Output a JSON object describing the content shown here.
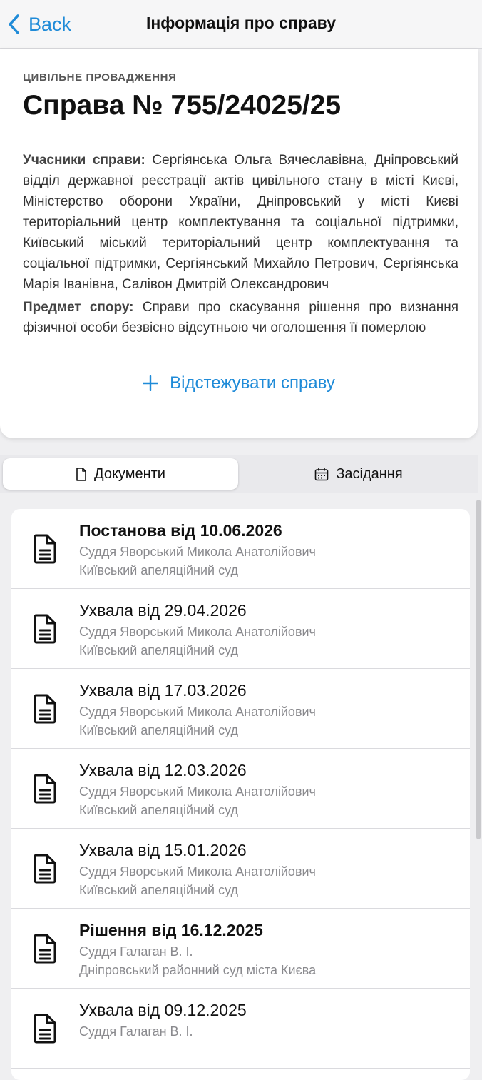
{
  "navbar": {
    "back_label": "Back",
    "title": "Інформація про справу"
  },
  "case": {
    "kind": "ЦИВІЛЬНЕ ПРОВАДЖЕННЯ",
    "title": "Справа № 755/24025/25",
    "participants_label": "Учасники справи:",
    "participants": "Сергіянська Ольга Вячеславівна, Дніпровський відділ державної реєстрації актів цивільного стану в місті Києві, Міністерство оборони України, Дніпровський у місті Києві територіальний центр комплектування та соціальної підтримки, Київський міський територіальний центр комплектування та соціальної підтримки, Сергіянський Михайло Петрович, Сергіянська Марія Іванівна, Салівон Дмитрій Олександрович",
    "subject_label": "Предмет спору:",
    "subject": "Справи про скасування рішення про визнання фізичної особи безвісно відсутньою чи оголошення її померлою",
    "track_label": "Відстежувати справу"
  },
  "tabs": {
    "documents": "Документи",
    "sessions": "Засідання",
    "active": "documents"
  },
  "documents": [
    {
      "title": "Постанова від 10.06.2026",
      "bold": true,
      "judge": "Суддя Яворський Микола Анатолійович",
      "court": "Київський апеляційний суд"
    },
    {
      "title": "Ухвала від 29.04.2026",
      "bold": false,
      "judge": "Суддя Яворський Микола Анатолійович",
      "court": "Київський апеляційний суд"
    },
    {
      "title": "Ухвала від 17.03.2026",
      "bold": false,
      "judge": "Суддя Яворський Микола Анатолійович",
      "court": "Київський апеляційний суд"
    },
    {
      "title": "Ухвала від 12.03.2026",
      "bold": false,
      "judge": "Суддя Яворський Микола Анатолійович",
      "court": "Київський апеляційний суд"
    },
    {
      "title": "Ухвала від 15.01.2026",
      "bold": false,
      "judge": "Суддя Яворський Микола Анатолійович",
      "court": "Київський апеляційний суд"
    },
    {
      "title": "Рішення від 16.12.2025",
      "bold": true,
      "judge": "Суддя Галаган В. І.",
      "court": "Дніпровський районний суд міста Києва"
    },
    {
      "title": "Ухвала від 09.12.2025",
      "bold": false,
      "judge": "Суддя Галаган В. І.",
      "court": ""
    }
  ],
  "colors": {
    "accent": "#1f8bd8",
    "secondary_text": "#8a8a8e"
  },
  "icons": {
    "back": "chevron-left-icon",
    "track": "plus-icon",
    "documents_tab": "file-icon",
    "sessions_tab": "calendar-icon",
    "row": "document-lines-icon"
  }
}
